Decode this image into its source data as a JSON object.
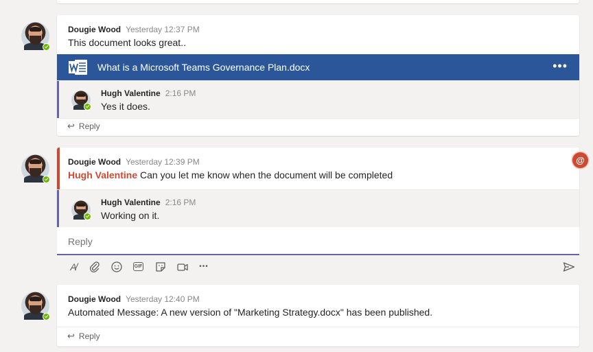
{
  "thread1": {
    "author": "Dougie Wood",
    "time": "Yesterday 12:37 PM",
    "message": "This document looks great..",
    "file": {
      "title": "What is a Microsoft Teams Governance Plan.docx",
      "icon": "word-icon",
      "more": "•••"
    },
    "reply": {
      "author": "Hugh Valentine",
      "time": "2:16 PM",
      "message": "Yes it does."
    },
    "reply_label": "Reply"
  },
  "thread2": {
    "author": "Dougie Wood",
    "time": "Yesterday 12:39 PM",
    "mention": "Hugh Valentine",
    "message": " Can you let me know when the document will be completed",
    "reply": {
      "author": "Hugh Valentine",
      "time": "2:16 PM",
      "message": "Working on it."
    },
    "mention_badge": "@",
    "compose_placeholder": "Reply"
  },
  "thread3": {
    "author": "Dougie Wood",
    "time": "Yesterday 12:40 PM",
    "message": "Automated Message: A new version of \"Marketing Strategy.docx\" has been published.",
    "reply_label": "Reply"
  },
  "toolbar": {
    "format_icon": "A̸",
    "gif_label": "GIF",
    "more_icon": "•••"
  },
  "colors": {
    "accent": "#6264a7",
    "word_blue": "#2b579a",
    "mention": "#cc4a31",
    "presence": "#6bb700"
  }
}
